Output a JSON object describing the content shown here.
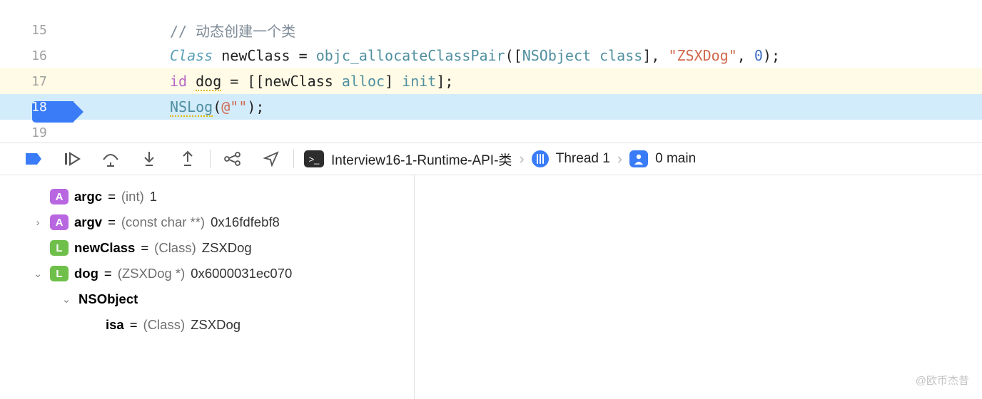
{
  "code": {
    "lines": [
      {
        "num": "15",
        "kind": "plain",
        "tokens": [
          {
            "t": "// 动态创建一个类",
            "c": "tok-comment"
          }
        ]
      },
      {
        "num": "16",
        "kind": "plain",
        "tokens": [
          {
            "t": "Class",
            "c": "tok-type"
          },
          {
            "t": " newClass = "
          },
          {
            "t": "objc_allocateClassPair",
            "c": "tok-func"
          },
          {
            "t": "(["
          },
          {
            "t": "NSObject",
            "c": "tok-func"
          },
          {
            "t": " "
          },
          {
            "t": "class",
            "c": "tok-func"
          },
          {
            "t": "], "
          },
          {
            "t": "\"ZSXDog\"",
            "c": "tok-string"
          },
          {
            "t": ", "
          },
          {
            "t": "0",
            "c": "tok-num"
          },
          {
            "t": ");"
          }
        ]
      },
      {
        "num": "17",
        "kind": "warn",
        "tokens": [
          {
            "t": "id",
            "c": "tok-keyword"
          },
          {
            "t": " "
          },
          {
            "t": "dog",
            "c": "tok-underline"
          },
          {
            "t": " = [[newClass "
          },
          {
            "t": "alloc",
            "c": "tok-func"
          },
          {
            "t": "] "
          },
          {
            "t": "init",
            "c": "tok-func"
          },
          {
            "t": "];"
          }
        ]
      },
      {
        "num": "18",
        "kind": "bp",
        "tokens": [
          {
            "t": "NSLog",
            "c": "tok-func tok-underline"
          },
          {
            "t": "("
          },
          {
            "t": "@\"\"",
            "c": "tok-string"
          },
          {
            "t": ");"
          }
        ]
      },
      {
        "num": "19",
        "kind": "plain",
        "tokens": []
      }
    ]
  },
  "breadcrumb": {
    "target": "Interview16-1-Runtime-API-类",
    "thread": "Thread 1",
    "frame": "0 main"
  },
  "vars": [
    {
      "disclosure": "",
      "badge": "A",
      "badgeClass": "badge-A",
      "name": "argc",
      "type": "(int)",
      "value": "1",
      "indent": 0
    },
    {
      "disclosure": ">",
      "badge": "A",
      "badgeClass": "badge-A",
      "name": "argv",
      "type": "(const char **)",
      "value": "0x16fdfebf8",
      "indent": 0
    },
    {
      "disclosure": "",
      "badge": "L",
      "badgeClass": "badge-L",
      "name": "newClass",
      "type": "(Class)",
      "value": "ZSXDog",
      "indent": 0
    },
    {
      "disclosure": "v",
      "badge": "L",
      "badgeClass": "badge-L",
      "name": "dog",
      "type": "(ZSXDog *)",
      "value": "0x6000031ec070",
      "indent": 0
    },
    {
      "disclosure": "v",
      "badge": "",
      "badgeClass": "",
      "name": "NSObject",
      "type": "",
      "value": "",
      "indent": 1
    },
    {
      "disclosure": "",
      "badge": "",
      "badgeClass": "",
      "name": "isa",
      "type": "(Class)",
      "value": "ZSXDog",
      "indent": 2
    }
  ],
  "watermark": "@欧币杰昔"
}
